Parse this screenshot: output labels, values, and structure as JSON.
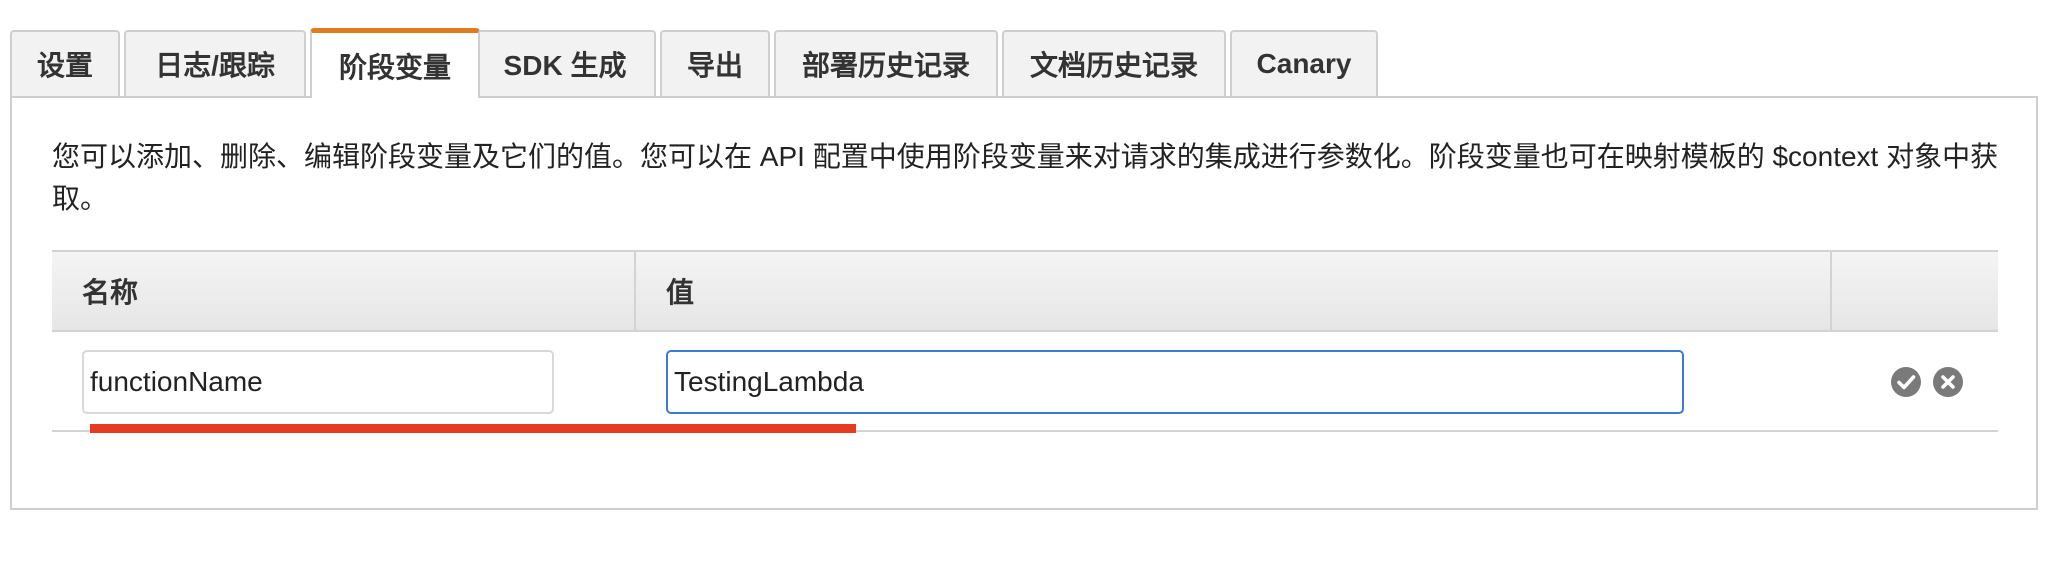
{
  "tabs": [
    {
      "label": "设置"
    },
    {
      "label": "日志/跟踪"
    },
    {
      "label": "阶段变量"
    },
    {
      "label": "SDK 生成"
    },
    {
      "label": "导出"
    },
    {
      "label": "部署历史记录"
    },
    {
      "label": "文档历史记录"
    },
    {
      "label": "Canary"
    }
  ],
  "active_tab": "阶段变量",
  "description": "您可以添加、删除、编辑阶段变量及它们的值。您可以在 API 配置中使用阶段变量来对请求的集成进行参数化。阶段变量也可在映射模板的 $context 对象中获取。",
  "table": {
    "headers": {
      "name": "名称",
      "value": "值",
      "actions": ""
    },
    "rows": [
      {
        "name": "functionName",
        "value": "TestingLambda"
      }
    ]
  },
  "row_actions": {
    "confirm_icon": "check-circle-icon",
    "cancel_icon": "x-circle-icon"
  },
  "colors": {
    "active_tab_accent": "#e07b1f",
    "focus_border": "#3b7bd6",
    "annotation_underline": "#e63a22"
  }
}
